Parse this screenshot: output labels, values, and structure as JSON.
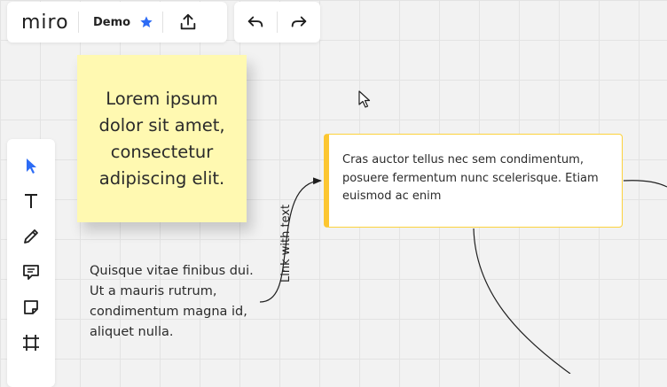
{
  "app": {
    "logo": "miro",
    "board_name": "Demo"
  },
  "colors": {
    "accent_blue": "#2d6cf5",
    "sticky_yellow": "#fff9b1",
    "card_accent": "#fcc631"
  },
  "toolbar": {
    "tools": [
      {
        "name": "select",
        "icon": "cursor-icon"
      },
      {
        "name": "text",
        "icon": "text-icon"
      },
      {
        "name": "pen",
        "icon": "pen-icon"
      },
      {
        "name": "comment",
        "icon": "comment-icon"
      },
      {
        "name": "sticky-note",
        "icon": "sticky-note-icon"
      },
      {
        "name": "frame",
        "icon": "frame-icon"
      }
    ]
  },
  "canvas": {
    "sticky_note": {
      "text": "Lorem ipsum dolor sit amet, consectetur adipiscing elit."
    },
    "free_text": {
      "text": "Quisque vitae finibus dui. Ut a mauris rutrum, condimentum magna id, aliquet nulla."
    },
    "card": {
      "text": "Cras auctor tellus nec sem condimentum, posuere fermentum nunc scelerisque. Etiam euismod ac enim"
    },
    "connector": {
      "label": "Link with text"
    }
  }
}
